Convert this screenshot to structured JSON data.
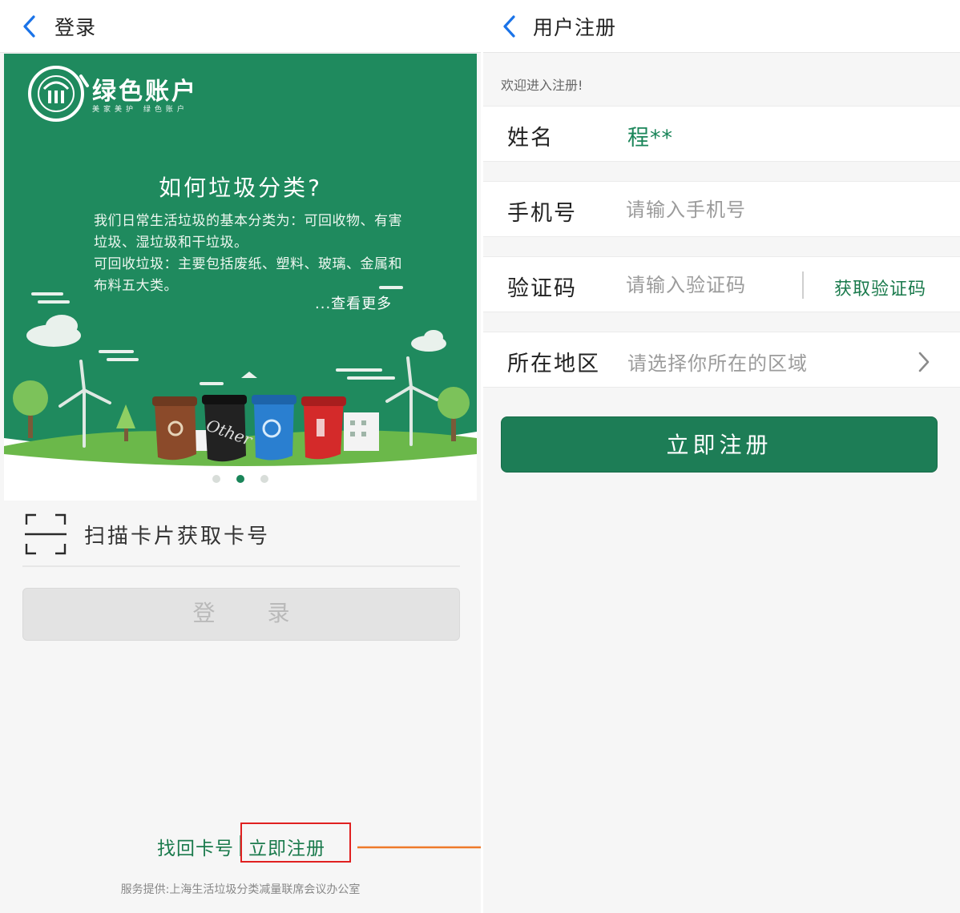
{
  "login_screen": {
    "title": "登录",
    "back_icon": "chevron-left-icon",
    "banner": {
      "brand_name": "绿色账户",
      "brand_subtitle": "美家美护 绿色账户",
      "heading": "如何垃圾分类?",
      "paragraph1": "我们日常生活垃圾的基本分类为：可回收物、有害垃圾、湿垃圾和干垃圾。",
      "paragraph2": "可回收垃圾：主要包括废纸、塑料、玻璃、金属和布料五大类。",
      "more_link": "...查看更多",
      "bin_label": "Other",
      "background_color": "#1f8a5e",
      "bin_colors": [
        "#8b4a2a",
        "#222222",
        "#2a7fd0",
        "#d42a2a"
      ]
    },
    "carousel": {
      "dot_count": 3,
      "active_index": 1
    },
    "scan_card": {
      "icon": "scan-icon",
      "label": "扫描卡片获取卡号"
    },
    "login_button": "登 录",
    "find_card_link": "找回卡号",
    "register_link": "立即注册",
    "provider": "服务提供:上海生活垃圾分类减量联席会议办公室"
  },
  "register_screen": {
    "title": "用户注册",
    "back_icon": "chevron-left-icon",
    "welcome": "欢迎进入注册!",
    "name": {
      "label": "姓名",
      "value": "程**"
    },
    "phone": {
      "label": "手机号",
      "placeholder": "请输入手机号"
    },
    "code": {
      "label": "验证码",
      "placeholder": "请输入验证码",
      "get_code": "获取验证码"
    },
    "region": {
      "label": "所在地区",
      "placeholder": "请选择你所在的区域",
      "icon": "chevron-right-icon"
    },
    "submit_button": "立即注册"
  },
  "colors": {
    "accent_green": "#1d7d56",
    "link_green": "#1a7a4c",
    "nav_blue": "#1a73e8",
    "highlight_red": "#e02020",
    "arrow_orange": "#ee7a2a"
  }
}
